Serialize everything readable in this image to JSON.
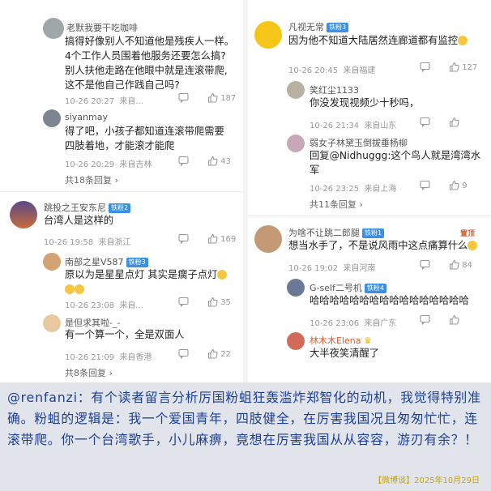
{
  "left": {
    "threads": [
      {
        "user": "老默我要干吃咖啡",
        "text": [
          "搞得好像别人不知道他是残疾人一样。",
          "4个工作人员围着他服务还要怎么搞?",
          "别人扶他走路在他眼中就是连滚带爬,",
          "这不是他自己作践自己吗?"
        ],
        "time": "10-26 20:27",
        "location": "来自...",
        "likes": "187"
      },
      {
        "user": "siyanmay",
        "text": [
          "得了吧，小孩子都知道连滚带爬需要",
          "四肢着地，才能滚才能爬"
        ],
        "time": "10-26 20:29",
        "location": "来自吉林",
        "likes": "43",
        "more": "共18条回复"
      },
      {
        "user": "跳投之王安东尼",
        "badge": "铁粉2",
        "text": [
          "台湾人是这样的"
        ],
        "time": "10-26 19:58",
        "location": "来自浙江",
        "likes": "169"
      },
      {
        "user": "南部之星V587",
        "badge": "铁粉3",
        "text": [
          "原以为是星星点灯 其实是瘸子点灯"
        ],
        "time": "10-26 23:08",
        "location": "来自...",
        "likes": "35"
      },
      {
        "user": "是但求其啦-_-",
        "text": [
          "有一个算一个，全是双面人"
        ],
        "time": "10-26 21:09",
        "location": "来自香港",
        "likes": "22",
        "more": "共8条回复"
      }
    ]
  },
  "right": {
    "threads": [
      {
        "user": "凡视无常",
        "badge": "铁粉3",
        "text": [
          "因为他不知道大陆居然连廊道都有监控"
        ],
        "time": "10-26 20:45",
        "location": "来自福建",
        "likes": "127"
      },
      {
        "user": "笑红尘1133",
        "text": [
          "你没发现视频少十秒吗，"
        ],
        "time": "10-26 21:34",
        "location": "来自山东",
        "likes": ""
      },
      {
        "user": "弱女子林黛玉倒拔垂杨柳",
        "text": [
          "回复@Nidhuggg:这个鸟人就是湾湾水",
          "军"
        ],
        "time": "10-26 23:25",
        "location": "来自上海",
        "likes": "9",
        "more": "共11条回复"
      },
      {
        "user": "为啥不让跳二郎腿",
        "badge": "铁粉1",
        "tag": "置顶",
        "text": [
          "想当水手了，不是说风雨中这点痛算什么"
        ],
        "time": "10-26 19:02",
        "location": "来自河南",
        "likes": "84"
      },
      {
        "user": "G-self二号机",
        "badge": "铁粉4",
        "text": [
          "哈哈哈哈哈哈哈哈哈哈哈哈哈哈哈哈"
        ],
        "time": "10-26 23:06",
        "location": "来自广东",
        "likes": ""
      },
      {
        "user": "林木木Elena",
        "text": [
          "大半夜笑清醒了"
        ],
        "time": "",
        "location": "",
        "likes": ""
      }
    ]
  },
  "quote": {
    "text": "@renfanzi：有个读者留言分析厉国粉蛆狂轰滥炸郑智化的动机，我觉得特别准确。粉蛆的逻辑是：我一个爱国青年，四肢健全，在厉害我国况且匆匆忙忙，连滚带爬。你一个台湾歌手，小儿麻痹，竟想在厉害我国从从容容，游刃有余？！"
  },
  "footer": {
    "text": "【微博谈】2025年10月29日"
  },
  "icons": {
    "reply": "comment-icon",
    "like": "like-icon"
  },
  "colors": {
    "quote_bg": "#e2e4ec",
    "quote_text": "#1c3f95",
    "badge": "#3a8fe8",
    "footer": "#c9a200"
  }
}
